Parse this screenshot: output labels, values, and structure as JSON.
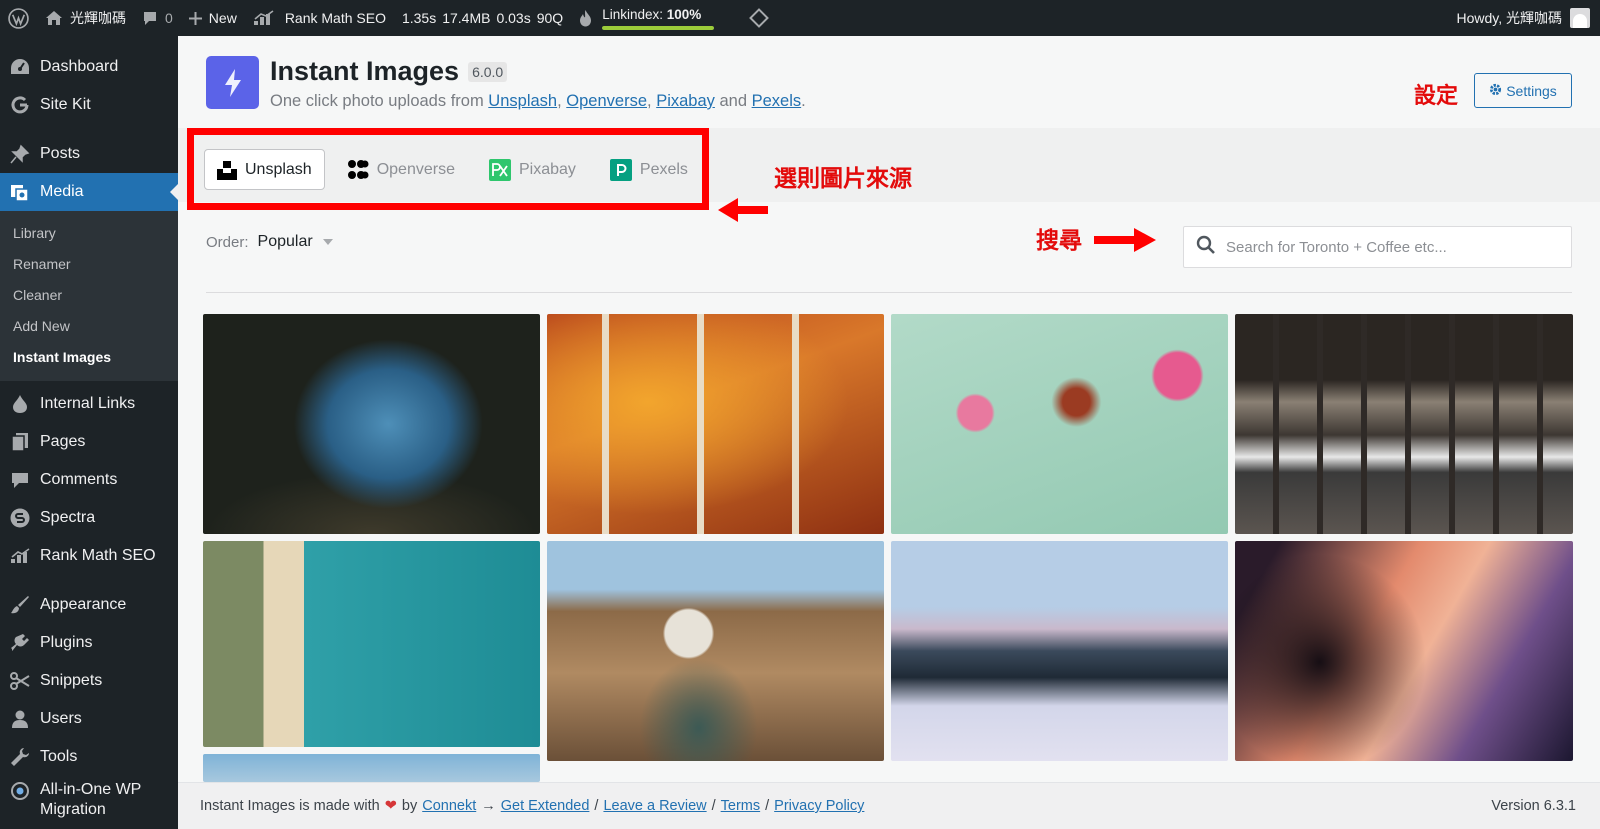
{
  "adminbar": {
    "site_name": "光輝咖碼",
    "comments_count": "0",
    "new_label": "New",
    "rank_math_label": "Rank Math SEO",
    "perf_time": "1.35s",
    "perf_memory": "17.4MB",
    "perf_query_time": "0.03s",
    "perf_queries": "90Q",
    "linkindex_label": "Linkindex:",
    "linkindex_value": "100%",
    "linkindex_fraction": 1.0,
    "howdy": "Howdy, 光輝咖碼"
  },
  "sidebar": {
    "items": [
      {
        "label": "Dashboard",
        "icon": "dashboard-icon"
      },
      {
        "label": "Site Kit",
        "icon": "google-g-icon"
      },
      {
        "label": "Posts",
        "icon": "pushpin-icon"
      },
      {
        "label": "Media",
        "icon": "media-icon",
        "current": true
      },
      {
        "label": "Internal Links",
        "icon": "drop-icon"
      },
      {
        "label": "Pages",
        "icon": "pages-icon"
      },
      {
        "label": "Comments",
        "icon": "comment-icon"
      },
      {
        "label": "Spectra",
        "icon": "spectra-icon"
      },
      {
        "label": "Rank Math SEO",
        "icon": "chart-icon"
      },
      {
        "label": "Appearance",
        "icon": "brush-icon"
      },
      {
        "label": "Plugins",
        "icon": "plugin-icon"
      },
      {
        "label": "Snippets",
        "icon": "scissors-icon"
      },
      {
        "label": "Users",
        "icon": "user-icon"
      },
      {
        "label": "Tools",
        "icon": "wrench-icon"
      },
      {
        "label": "All-in-One WP Migration",
        "icon": "migration-icon"
      }
    ],
    "media_submenu": [
      "Library",
      "Renamer",
      "Cleaner",
      "Add New",
      "Instant Images"
    ]
  },
  "plugin": {
    "title": "Instant Images",
    "version": "6.0.0",
    "tagline_prefix": "One click photo uploads from",
    "source_links": [
      "Unsplash",
      "Openverse",
      "Pixabay",
      "Pexels"
    ],
    "tagline_and": "and",
    "tagline_comma": ",",
    "tagline_period": "."
  },
  "settings": {
    "annotation": "設定",
    "button_label": "Settings"
  },
  "sources": {
    "tabs": [
      "Unsplash",
      "Openverse",
      "Pixabay",
      "Pexels"
    ],
    "active": "Unsplash",
    "annotation": "選則圖片來源"
  },
  "order": {
    "label": "Order:",
    "value": "Popular"
  },
  "search": {
    "annotation": "搜尋",
    "placeholder": "Search for Toronto + Coffee etc..."
  },
  "colors": {
    "accent": "#2271b1",
    "admin_bg": "#1d2327",
    "annotation_red": "#e30b0b",
    "plugin_logo": "#5b63e8"
  },
  "footer": {
    "made_with": "Instant Images is made with",
    "by": "by",
    "arrow": "→",
    "slash": "/",
    "links": [
      "Connekt",
      "Get Extended",
      "Leave a Review",
      "Terms",
      "Privacy Policy"
    ],
    "version": "Version 6.3.1"
  }
}
